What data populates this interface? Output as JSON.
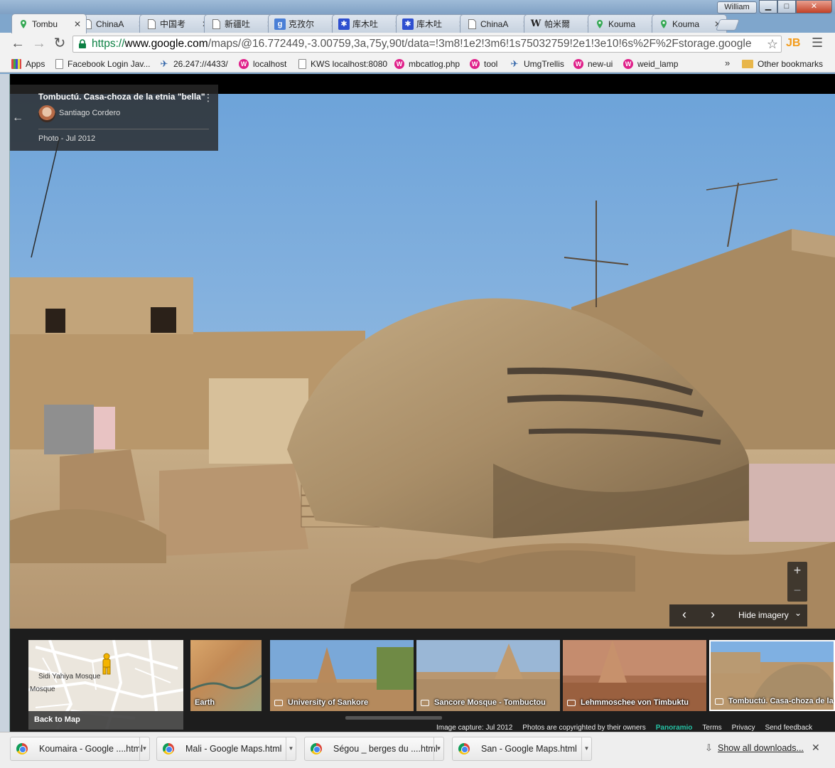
{
  "window": {
    "user": "William",
    "minimize": "▁",
    "maximize": "□",
    "close": "✕"
  },
  "tabs": [
    {
      "title": "Tombu",
      "icon": "google-maps-icon",
      "active": true
    },
    {
      "title": "ChinaA",
      "icon": "document-icon"
    },
    {
      "title": "中国考",
      "icon": "document-icon"
    },
    {
      "title": "新疆吐",
      "icon": "document-icon"
    },
    {
      "title": "克孜尔",
      "icon": "google-search-icon"
    },
    {
      "title": "库木吐",
      "icon": "baidu-paw-icon"
    },
    {
      "title": "库木吐",
      "icon": "baidu-paw-icon"
    },
    {
      "title": "ChinaA",
      "icon": "document-icon"
    },
    {
      "title": "帕米爾",
      "icon": "wikipedia-icon"
    },
    {
      "title": "Kouma",
      "icon": "google-maps-icon"
    },
    {
      "title": "Kouma",
      "icon": "google-maps-icon"
    }
  ],
  "toolbar": {
    "url_scheme": "https://",
    "url_host": "www.google.com",
    "url_path": "/maps/@16.772449,-3.00759,3a,75y,90t/data=!3m8!1e2!3m6!1s75032759!2e1!3e10!6s%2F%2Fstorage.google",
    "ext_label": "JB"
  },
  "bookmarks": {
    "items": [
      {
        "label": "Apps",
        "icon": "apps-grid-icon"
      },
      {
        "label": "Facebook Login Jav...",
        "icon": "document-icon"
      },
      {
        "label": "26.247://4433/",
        "icon": "plane-icon"
      },
      {
        "label": "localhost",
        "icon": "w-icon"
      },
      {
        "label": "KWS localhost:8080",
        "icon": "document-icon"
      },
      {
        "label": "mbcatlog.php",
        "icon": "w-icon"
      },
      {
        "label": "tool",
        "icon": "w-icon"
      },
      {
        "label": "UmgTrellis",
        "icon": "plane-icon"
      },
      {
        "label": "new-ui",
        "icon": "w-icon"
      },
      {
        "label": "weid_lamp",
        "icon": "w-icon"
      }
    ],
    "overflow": "»",
    "other": "Other bookmarks"
  },
  "photo_card": {
    "title": "Tombuctú. Casa-choza de la etnia \"bella\"",
    "author": "Santiago Cordero",
    "date": "Photo - Jul 2012"
  },
  "controls": {
    "zoom_in": "+",
    "zoom_out": "−",
    "prev": "‹",
    "next": "›",
    "hide_imagery": "Hide imagery"
  },
  "minimap": {
    "label_1": "Sidi Yahiya Mosque",
    "label_2": "Mosque",
    "back_to_map": "Back to Map"
  },
  "thumbnails": [
    {
      "label": "Earth",
      "camera": false
    },
    {
      "label": "University of Sankore",
      "camera": true
    },
    {
      "label": "Sancore Mosque - Tombuctou",
      "camera": true
    },
    {
      "label": "Lehmmoschee von Timbuktu",
      "camera": true
    },
    {
      "label": "Tombuctú. Casa-choza de la",
      "camera": true
    }
  ],
  "footer": {
    "capture": "Image capture: Jul 2012",
    "copyright": "Photos are copyrighted by their owners",
    "panoramio": "Panoramio",
    "terms": "Terms",
    "privacy": "Privacy",
    "feedback": "Send feedback"
  },
  "downloads": {
    "items": [
      {
        "name": "Koumaira - Google ....html"
      },
      {
        "name": "Mali - Google Maps.html"
      },
      {
        "name": "Ségou _ berges du ....html"
      },
      {
        "name": "San - Google Maps.html"
      }
    ],
    "show_all": "Show all downloads...",
    "close": "✕"
  },
  "colors": {
    "sky": "#7aaee0",
    "mud": "#b99a72",
    "panel": "#282828",
    "panoramio": "#25c1a4"
  }
}
